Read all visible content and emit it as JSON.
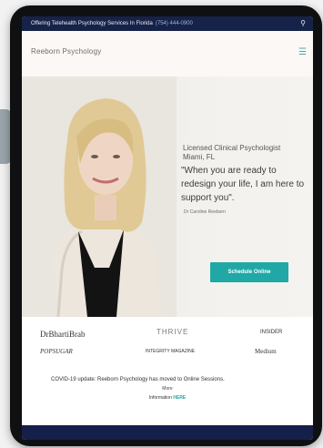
{
  "topbar": {
    "announcement": "Offering Telehealth Psychology Services In Florida",
    "phone": "(754) 444-0900",
    "search_icon": "search-icon"
  },
  "header": {
    "logo_text": "Reeborn Psychology",
    "menu_icon": "hamburger-menu-icon"
  },
  "hero": {
    "subtitle_line1": "Licensed Clinical Psychologist",
    "subtitle_line2": "Miami, FL",
    "quote": "\"When you are ready to redesign your life, I am here to support you\".",
    "signature": "Dr Caroline Reeborn",
    "cta_label": "Schedule Online"
  },
  "featured_logos": [
    "DrBhartiBrab",
    "THRIVE",
    "INSIDER",
    "POPSUGAR",
    "INTEGRITY MAGAZINE",
    "Medium"
  ],
  "notice": {
    "line1": "COVID-19 update: Reeborn Psychology has moved to Online Sessions.",
    "line2": "More",
    "line3_prefix": "Information",
    "line3_link": "HERE"
  },
  "colors": {
    "topbar": "#162247",
    "accent": "#1fa8a6",
    "footer": "#15204a"
  }
}
